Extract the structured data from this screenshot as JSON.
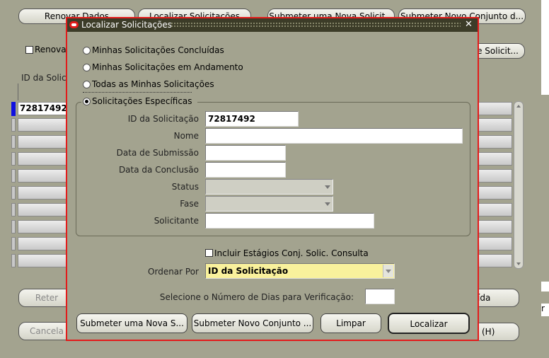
{
  "background": {
    "top_buttons": [
      "Renovar Dados",
      "Localizar Solicitações",
      "Submeter uma Nova Solicit...",
      "Submeter Novo Conjunto d..."
    ],
    "renovar_label": "Renovação",
    "right_partial_button": "e Solicit...",
    "id_header": "ID da Solic",
    "first_row_id": "72817492",
    "bottom_left_1": "Reter",
    "bottom_left_2": "Cancela",
    "bottom_right_1": "ída",
    "bottom_right_2": "(H)",
    "right_edge_char": "r"
  },
  "dialog": {
    "title": "Localizar Solicitações",
    "close_glyph": "✕",
    "options": {
      "concluidas": "Minhas Solicitações Concluídas",
      "andamento": "Minhas Solicitações em Andamento",
      "todas": "Todas as Minhas Solicitações",
      "especificas": "Solicitações Específicas"
    },
    "labels": {
      "id": "ID da Solicitação",
      "nome": "Nome",
      "data_submissao": "Data de Submissão",
      "data_conclusao": "Data da Conclusão",
      "status": "Status",
      "fase": "Fase",
      "solicitante": "Solicitante",
      "incluir": "Incluir Estágios Conj. Solic. Consulta",
      "ordenar_por": "Ordenar Por",
      "dias": "Selecione o Número de Dias para Verificação:"
    },
    "values": {
      "id": "72817492",
      "nome": "",
      "data_submissao": "",
      "data_conclusao": "",
      "status": "",
      "fase": "",
      "solicitante": "",
      "ordenar_por": "ID da Solicitação",
      "dias": ""
    },
    "buttons": {
      "submeter_nova": "Submeter uma Nova S...",
      "submeter_conjunto": "Submeter Novo Conjunto ...",
      "limpar": "Limpar",
      "localizar": "Localizar"
    }
  }
}
